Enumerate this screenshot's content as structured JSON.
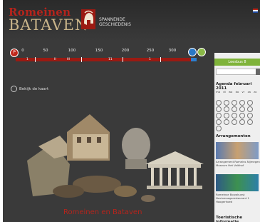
{
  "header": {
    "brand_line1": "Romeinen",
    "brand_line2": "BATAVEN",
    "tagline_line1": "SPANNENDE",
    "tagline_line2": "GESCHIEDENIS"
  },
  "timeline": {
    "prev_label": "P",
    "ticks": [
      "0",
      "50",
      "100",
      "150",
      "200",
      "250",
      "300"
    ],
    "markers": [
      "1",
      "II",
      "III",
      "11",
      "1"
    ]
  },
  "map_link": "Bekijk de kaart",
  "main_title": "Romeinen en Bataven",
  "sidebar": {
    "button_label": "Leesbus 8",
    "agenda_heading": "Agenda februari 2011",
    "calendar_days": [
      "ma",
      "di",
      "wo",
      "do",
      "vr",
      "za",
      "zo"
    ],
    "arrangementen_heading": "Arrangementen",
    "arr1_text": "Arrangement Romeins Nijmegen",
    "arr1_sub": "Museum Het Valkhof",
    "arr2_text": "Romeinse Bouwkunst",
    "arr2_sub": "Noviomaagsrestaurant 1",
    "arr2_sub2": "Hoogerhoed",
    "tourist_heading": "Toeristische informatie"
  }
}
